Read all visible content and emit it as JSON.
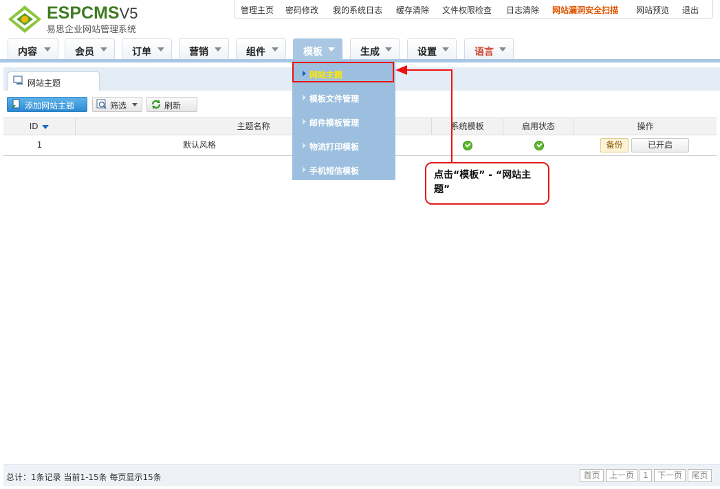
{
  "header": {
    "logo_word": "ESPCMS",
    "logo_version": "V5",
    "logo_subtitle": "易思企业网站管理系统"
  },
  "topnav": [
    "管理主页",
    "密码修改",
    "我的系统日志",
    "缓存清除",
    "文件权限检查",
    "日志清除",
    "网站漏洞安全扫描",
    "网站预览",
    "退出"
  ],
  "mainmenu": [
    "内容",
    "会员",
    "订单",
    "营销",
    "组件",
    "模板",
    "生成",
    "设置",
    "语言"
  ],
  "active_menu": "模板",
  "dropdown": [
    "网站主题",
    "模板文件管理",
    "邮件模板管理",
    "物流打印模板",
    "手机短信模板"
  ],
  "page_tab": "网站主题",
  "toolbar": {
    "add_label": "添加网站主题",
    "filter_label": "筛选",
    "refresh_label": "刷新"
  },
  "table": {
    "headers": [
      "ID",
      "主题名称",
      "系统模板",
      "启用状态",
      "操作"
    ],
    "rows": [
      {
        "id": "1",
        "name": "默认风格",
        "system": true,
        "enabled": true,
        "backup": "备份",
        "status_btn": "已开启"
      }
    ]
  },
  "callout": "点击“模板” - “网站主题”",
  "footer": {
    "info": "总计：1条记录 当前1-15条 每页显示15条",
    "pager": [
      "首页",
      "上一页",
      "1",
      "下一页",
      "尾页"
    ]
  },
  "colors": {
    "brand_green": "#3f7b1f",
    "menu_blue": "#a9c6e3",
    "alert_orange": "#e05300",
    "annotation_red": "#ee1111"
  }
}
